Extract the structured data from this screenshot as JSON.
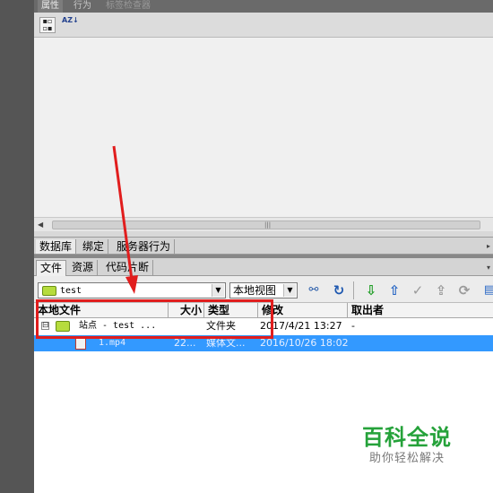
{
  "properties_panel": {
    "tabs": [
      "属性",
      "行为",
      "标签检查器"
    ],
    "sort_category_label": "",
    "sort_alpha_label": "AZ↓"
  },
  "database_panel": {
    "tabs": [
      "数据库",
      "绑定",
      "服务器行为"
    ]
  },
  "files_panel": {
    "tabs": [
      "文件",
      "资源",
      "代码片断"
    ],
    "site_select": {
      "value": "test"
    },
    "view_select": {
      "value": "本地视图"
    },
    "toolbar_icons": [
      "connect-icon",
      "refresh-icon",
      "get-icon",
      "put-icon",
      "check-out-icon",
      "check-in-icon",
      "sync-icon",
      "expand-icon"
    ],
    "columns": {
      "name": "本地文件",
      "size": "大小",
      "type": "类型",
      "modified": "修改",
      "checked_out_by": "取出者"
    },
    "rows": [
      {
        "expander": "⊟",
        "name": "站点 - test ...",
        "size": "",
        "type": "文件夹",
        "modified": "2017/4/21 13:27",
        "checked_out_by": "-"
      },
      {
        "name": "1.mp4",
        "size": "22...",
        "type": "媒体文...",
        "modified": "2016/10/26 18:02",
        "checked_out_by": ""
      }
    ]
  },
  "watermark": {
    "title": "百科全说",
    "subtitle": "助你轻松解决"
  },
  "colors": {
    "annotation": "#e11d1d",
    "selection": "#3399ff",
    "watermark_green": "#25a23a"
  }
}
